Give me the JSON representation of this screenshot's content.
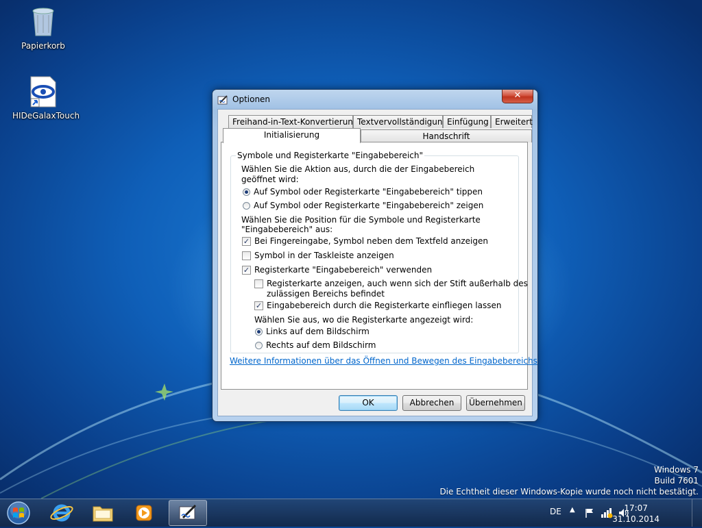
{
  "desktop": {
    "icons": [
      {
        "label": "Papierkorb",
        "icon": "recycle-bin-icon"
      },
      {
        "label": "HIDeGalaxTouch",
        "icon": "app-shortcut-icon"
      }
    ],
    "watermark": {
      "line1": "Windows 7",
      "line2": "Build 7601",
      "line3": "Die Echtheit dieser Windows-Kopie wurde noch nicht bestätigt."
    }
  },
  "dialog": {
    "title": "Optionen",
    "close_label": "✕",
    "tabs_row1": [
      "Freihand-in-Text-Konvertierung",
      "Textvervollständigung",
      "Einfügung",
      "Erweitert"
    ],
    "tabs_row2": [
      "Initialisierung",
      "Handschrift"
    ],
    "active_tab": "Initialisierung",
    "group_title": "Symbole und Registerkarte \"Eingabebereich\"",
    "action_prompt_l1": "Wählen Sie die Aktion aus, durch die der Eingabebereich",
    "action_prompt_l2": "geöffnet wird:",
    "radio_tap": {
      "label": "Auf Symbol oder Registerkarte \"Eingabebereich\" tippen",
      "checked": true
    },
    "radio_point": {
      "label": "Auf Symbol oder Registerkarte \"Eingabebereich\" zeigen",
      "checked": false
    },
    "position_prompt_l1": "Wählen Sie die Position für die Symbole und Registerkarte",
    "position_prompt_l2": "\"Eingabebereich\" aus:",
    "check_finger": {
      "label": "Bei Fingereingabe, Symbol neben dem Textfeld anzeigen",
      "checked": true
    },
    "check_taskbar": {
      "label": "Symbol in der Taskleiste anzeigen",
      "checked": false
    },
    "check_tab": {
      "label": "Registerkarte \"Eingabebereich\" verwenden",
      "checked": true
    },
    "check_outside_l1": {
      "label": "Registerkarte anzeigen, auch wenn sich der Stift außerhalb des",
      "checked": false
    },
    "check_outside_l2": "zulässigen Bereichs befindet",
    "check_slide": {
      "label": "Eingabebereich durch die Registerkarte einfliegen lassen",
      "checked": true
    },
    "side_prompt": "Wählen Sie aus, wo die Registerkarte angezeigt wird:",
    "radio_left": {
      "label": "Links auf dem Bildschirm",
      "checked": true
    },
    "radio_right": {
      "label": "Rechts auf dem Bildschirm",
      "checked": false
    },
    "info_link": "Weitere Informationen über das Öffnen und Bewegen des Eingabebereichs",
    "buttons": {
      "ok": "OK",
      "cancel": "Abbrechen",
      "apply": "Übernehmen"
    }
  },
  "taskbar": {
    "items": [
      "start-orb",
      "internet-explorer",
      "windows-explorer",
      "media-player",
      "input-panel-options"
    ],
    "language": "DE",
    "time": "17:07",
    "date": "31.10.2014"
  },
  "colors": {
    "link": "#0066cc",
    "desktop": "#0f5fb8"
  }
}
